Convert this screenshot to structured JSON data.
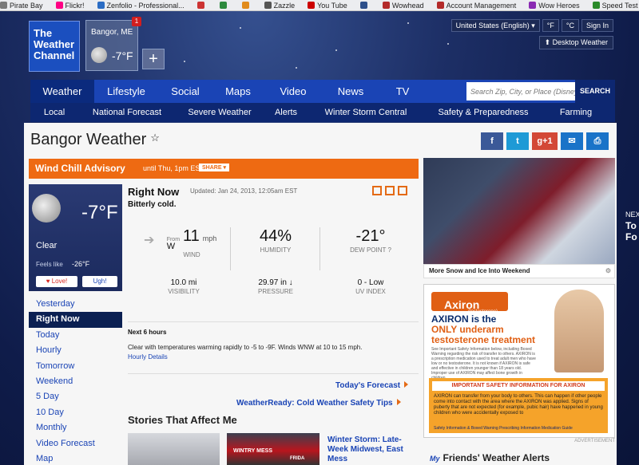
{
  "bookmarks": [
    {
      "label": "Pirate Bay",
      "color": "#7a7a7a"
    },
    {
      "label": "Flickr!",
      "color": "#ff0084"
    },
    {
      "label": "Zenfolio - Professional...",
      "color": "#2b6cc4"
    },
    {
      "label": "",
      "color": "#cc3333"
    },
    {
      "label": "",
      "color": "#2d8a3e"
    },
    {
      "label": "",
      "color": "#e18b1c"
    },
    {
      "label": "Zazzle",
      "color": "#555555"
    },
    {
      "label": "You Tube",
      "color": "#cc0000"
    },
    {
      "label": "",
      "color": "#2d4f8a"
    },
    {
      "label": "Wowhead",
      "color": "#b32a2a"
    },
    {
      "label": "Account Management",
      "color": "#b32a2a"
    },
    {
      "label": "Wow Heroes",
      "color": "#8a2ab3"
    },
    {
      "label": "Speed Test | Bandwidt...",
      "color": "#2a8a2a"
    }
  ],
  "header": {
    "logo_lines": [
      "The",
      "Weather",
      "Channel"
    ],
    "saved_location": {
      "name": "Bangor, ME",
      "temp": "-7°F",
      "badge": "1"
    },
    "add_symbol": "+",
    "region_select": "United States (English)",
    "unit_f": "°F",
    "unit_c": "°C",
    "sign_in": "Sign In",
    "desktop_weather": "Desktop Weather"
  },
  "nav": {
    "items": [
      "Weather",
      "Lifestyle",
      "Social",
      "Maps",
      "Video",
      "News",
      "TV"
    ],
    "search_placeholder": "Search Zip, City, or Place (Disney World)",
    "search_button": "SEARCH"
  },
  "subnav": [
    "Local",
    "National Forecast",
    "Severe Weather",
    "Alerts",
    "Winter Storm Central",
    "Safety & Preparedness",
    "Farming"
  ],
  "page": {
    "title": "Bangor Weather",
    "star": "☆"
  },
  "social": [
    {
      "label": "f",
      "color": "#3b5998"
    },
    {
      "label": "t",
      "color": "#1e9ad6"
    },
    {
      "label": "g+1",
      "color": "#d34836"
    },
    {
      "label": "✉",
      "color": "#1a73c8"
    },
    {
      "label": "⎙",
      "color": "#1a73c8"
    }
  ],
  "advisory": {
    "title": "Wind Chill Advisory",
    "until": "until Thu, 1pm EST",
    "share": "SHARE ▾"
  },
  "current": {
    "temp": "-7°F",
    "condition": "Clear",
    "feels_like_label": "Feels like",
    "feels_like_value": "-26°F",
    "love": "♥ Love!",
    "ugh": "Ugh!"
  },
  "side_menu": [
    "Yesterday",
    "Right Now",
    "Today",
    "Hourly",
    "Tomorrow",
    "Weekend",
    "5 Day",
    "10 Day",
    "Monthly",
    "Video Forecast",
    "Map"
  ],
  "right_now": {
    "title": "Right Now",
    "updated": "Updated: Jan 24, 2013, 12:05am EST",
    "description": "Bitterly cold.",
    "wind_from": "From",
    "wind_dir": "W",
    "wind_speed": "11",
    "wind_unit": "mph",
    "wind_label": "WIND",
    "humidity": "44%",
    "humidity_label": "HUMIDITY",
    "dew_point": "-21°",
    "dew_label": "DEW POINT",
    "visibility": "10.0 mi",
    "visibility_label": "VISIBILITY",
    "pressure": "29.97 in ↓",
    "pressure_label": "PRESSURE",
    "uv": "0 - Low",
    "uv_label": "UV INDEX"
  },
  "next_hours": {
    "title": "Next 6 hours",
    "text": "Clear with temperatures warming rapidly to -5 to -9F. Winds WNW at 10 to 15 mph.",
    "link": "Hourly Details"
  },
  "links": {
    "todays_forecast": "Today's Forecast",
    "weatherready": "WeatherReady: Cold Weather Safety Tips"
  },
  "stories": {
    "title": "Stories That Affect Me",
    "thumb_text_1": "WINTRY MESS",
    "thumb_text_2": "FRIDA",
    "story_title": "Winter Storm: Late-Week Midwest, East Mess"
  },
  "video": {
    "caption": "More Snow and Ice Into Weekend",
    "gear": "⚙"
  },
  "ad": {
    "brand": "Axiron",
    "sub": "(testosterone) topical solution ⓒ",
    "headline_1": "AXIRON is the",
    "headline_2": "ONLY",
    "headline_3": " underarm testosterone treatment",
    "small_text": "See Important Safety Information below, including Boxed Warning regarding the risk of transfer to others. AXIRON is a prescription medication used to treat adult men who have low or no testosterone. It is not known if AXIRON is safe and effective in children younger than 18 years old. Improper use of AXIRON may affect bone growth in children.",
    "box_title": "IMPORTANT SAFETY INFORMATION FOR AXIRON",
    "box_text": "AXIRON can transfer from your body to others. This can happen if other people come into contact with the area where the AXIRON was applied. Signs of puberty that are not expected (for example, pubic hair) have happened in young children who were accidentally exposed to",
    "box_links": "Safety Information & Boxed Warning    Prescribing Information    Medication Guide",
    "label": "ADVERTISEMENT"
  },
  "friends": {
    "my": "My",
    "title": "Friends' Weather Alerts"
  },
  "edge": {
    "next": "NEXT",
    "line1": "To",
    "line2": "Fo"
  }
}
